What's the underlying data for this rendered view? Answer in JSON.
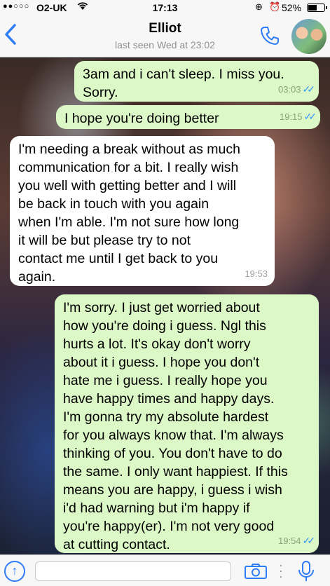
{
  "status_bar": {
    "carrier": "O2-UK",
    "time": "17:13",
    "battery_percent": "52%",
    "battery_level": 0.52
  },
  "header": {
    "back_icon": "chevron-left-icon",
    "contact_name": "Elliot",
    "last_seen": "last seen Wed at 23:02",
    "call_icon": "phone-icon"
  },
  "messages": [
    {
      "direction": "outgoing",
      "text": "3am and i can't sleep. I miss you.\nSorry.",
      "time": "03:03",
      "read": true
    },
    {
      "direction": "outgoing",
      "text": "I hope you're doing better",
      "time": "19:15",
      "read": true
    },
    {
      "direction": "incoming",
      "text": "I'm needing a break without as much\ncommunication for a bit. I really wish\nyou well with getting better and I will\nbe back in touch with you again\nwhen I'm able. I'm not sure how long\nit will be but please try to not\ncontact me until I get back to you\nagain.",
      "time": "19:53"
    },
    {
      "direction": "outgoing",
      "text": "I'm sorry. I just get worried about\nhow you're doing i guess. Ngl this\nhurts a lot. It's okay don't worry\nabout it i guess. I hope you don't\nhate me i guess. I really hope you\nhave happy times and happy days.\nI'm gonna try my absolute hardest\nfor you always know that. I'm always\nthinking of you. You don't have to do\nthe same. I only want happiest. If this\nmeans you are happy, i guess i wish\ni'd had warning but i'm happy if\nyou're happy(er). I'm not very good\nat cutting contact.",
      "time": "19:54",
      "read": true
    }
  ],
  "composer": {
    "placeholder": "",
    "icons": [
      "upload-icon",
      "camera-icon",
      "more-icon",
      "microphone-icon"
    ]
  },
  "colors": {
    "accent": "#2e7cf6",
    "outgoing_bubble": "#dcf8c6",
    "incoming_bubble": "#ffffff",
    "read_ticks": "#3497f9"
  }
}
